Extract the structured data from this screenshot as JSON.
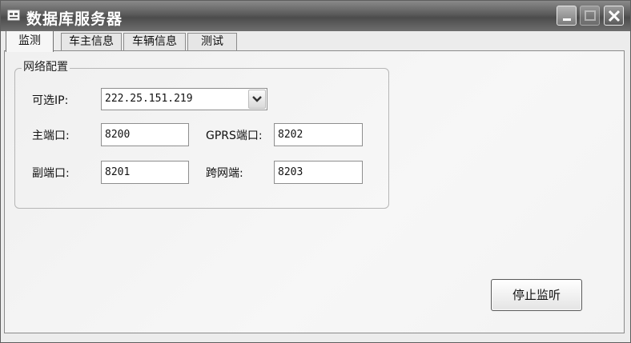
{
  "window": {
    "title": "数据库服务器"
  },
  "tabs": [
    {
      "label": "监测",
      "active": true
    },
    {
      "label": "车主信息",
      "active": false
    },
    {
      "label": "车辆信息",
      "active": false
    },
    {
      "label": "测试",
      "active": false
    }
  ],
  "network_group": {
    "title": "网络配置",
    "ip_label": "可选IP:",
    "ip_value": "222.25.151.219",
    "main_port_label": "主端口:",
    "main_port_value": "8200",
    "sub_port_label": "副端口:",
    "sub_port_value": "8201",
    "gprs_port_label": "GPRS端口:",
    "gprs_port_value": "8202",
    "cross_net_label": "跨网端:",
    "cross_net_value": "8203"
  },
  "actions": {
    "stop_label": "停止监听"
  },
  "icons": {
    "app": "window-app-icon",
    "minimize": "minimize-icon",
    "maximize": "maximize-icon",
    "close": "close-icon",
    "dropdown": "chevron-down-icon"
  }
}
